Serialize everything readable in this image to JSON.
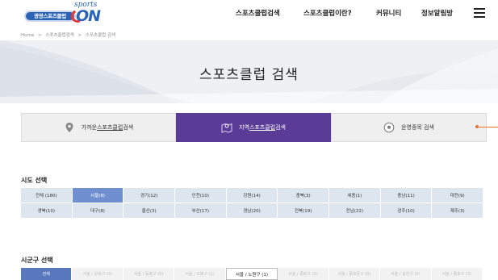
{
  "header": {
    "logo_pill": "광광스포츠클럽",
    "logo_sports": "sports",
    "logo_on": "ON",
    "nav": [
      "스포츠클럽검색",
      "스포츠클럽이란?",
      "커뮤니티",
      "정보알림방"
    ]
  },
  "breadcrumb": [
    "Home",
    ">",
    "스포츠클럽검색",
    ">",
    "스포츠클럽 검색"
  ],
  "page_title": "스포츠클럽 검색",
  "tabs": [
    {
      "prefix": "가까운 ",
      "underline": "스포츠클럽",
      "suffix": " 검색",
      "icon": "location-pin-icon"
    },
    {
      "prefix": "지역 ",
      "underline": "스포츠클럽",
      "suffix": " 검색",
      "icon": "map-icon"
    },
    {
      "prefix": "",
      "underline": "",
      "suffix": "운영종목 검색",
      "icon": "soccer-ball-icon"
    }
  ],
  "colors": {
    "accent": "#5a3c97",
    "selected_cell": "#6f8fd0",
    "cell_bg": "#dde6ef",
    "side_marker": "#e8742a"
  },
  "sido": {
    "title": "시도 선택",
    "rows": [
      [
        "전체 (180)",
        "서울(8)",
        "경기(12)",
        "인천(10)",
        "강원(14)",
        "충북(3)",
        "세종(1)",
        "충남(11)",
        "대전(9)"
      ],
      [
        "경북(10)",
        "대구(8)",
        "울산(3)",
        "부산(17)",
        "경남(20)",
        "전북(19)",
        "전남(22)",
        "광주(10)",
        "제주(3)"
      ]
    ],
    "selected": "서울(8)"
  },
  "sigungu": {
    "title": "시군구 선택",
    "items": [
      "전체",
      "서울 / 강북구 (0)",
      "서울 / 동봉구 (0)",
      "서울 / 도봉구 (1)",
      "서울 / 노원구 (1)",
      "서울 / 중랑구 (0)",
      "서울 / 동대문구 (0)",
      "서울 / 광진구 (0)",
      "서울 / 종로구 (0)"
    ],
    "selected": "서울 / 노원구 (1)"
  }
}
